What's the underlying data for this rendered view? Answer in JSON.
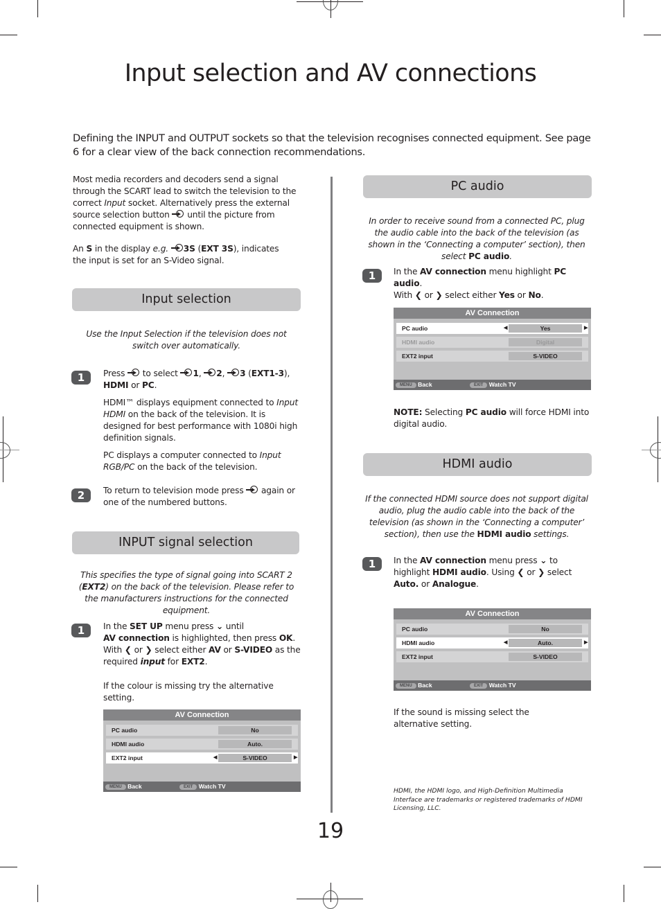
{
  "page": {
    "title": "Input selection and AV connections",
    "intro": "Defining the INPUT and OUTPUT sockets so that the television recognises connected equipment. See page 6 for a clear view of the back connection recommendations.",
    "page_number": "19"
  },
  "left": {
    "para1_a": "Most media recorders and decoders send a signal through the SCART lead to switch the television to the correct ",
    "para1_input": "Input",
    "para1_b": " socket. Alternatively press the external source selection button ",
    "para1_c": " until the picture from connected equipment is shown.",
    "para2_a": "An ",
    "para2_s": "S",
    "para2_b": " in the display ",
    "para2_eg": "e.g.",
    "para2_code": "3S",
    "para2_ext": "EXT 3S",
    "para2_c": "), indicates the input is set for an S-Video signal.",
    "input_selection": {
      "heading": "Input selection",
      "intro": "Use the Input Selection if the television does not switch over automatically.",
      "step1_num": "1",
      "step1_press": "Press ",
      "step1_toselect": " to select ",
      "step1_n1": "1",
      "step1_n2": "2",
      "step1_n3": "3",
      "step1_ext": "EXT1-3",
      "step1_hdmi": "HDMI",
      "step1_or": " or ",
      "step1_pc": "PC",
      "hdmi_a": "HDMI™ displays equipment connected to ",
      "hdmi_input": "Input HDMI",
      "hdmi_b": " on the back of the television. It is designed for best performance with 1080i high definition signals.",
      "pc_a": "PC displays a computer connected to ",
      "pc_input": "Input RGB/PC",
      "pc_b": " on the back of the television.",
      "step2_num": "2",
      "step2_a": "To return to television mode press ",
      "step2_b": " again or one of the numbered buttons."
    },
    "input_signal": {
      "heading": "INPUT signal selection",
      "intro_a": "This specifies the type of signal going into SCART 2 (",
      "intro_ext": "EXT2",
      "intro_b": ") on the back of the television. Please refer to the manufacturers instructions for the connected equipment.",
      "step1_num": "1",
      "s_a": "In the ",
      "s_setup": "SET UP",
      "s_b": " menu press ",
      "s_c": " until",
      "s_av": "AV connection",
      "s_d": " is highlighted, then press ",
      "s_ok": "OK",
      "s_with": "With ",
      "s_or": " or ",
      "s_e": " select either ",
      "s_avopt": "AV",
      "s_or2": " or ",
      "s_svideo": "S-VIDEO",
      "s_f": " as the required ",
      "s_input": "input",
      "s_for": " for ",
      "s_ext2": "EXT2",
      "note": "If the colour is missing try the alternative setting."
    }
  },
  "right": {
    "pc_audio": {
      "heading": "PC audio",
      "intro_a": "In order to receive sound from a connected PC, plug the audio cable into the back of the television (as shown in the ‘Connecting a computer’ section), then select ",
      "intro_b": "PC audio",
      "step1_num": "1",
      "s_a": "In the ",
      "s_av": "AV connection",
      "s_b": " menu highlight ",
      "s_pc": "PC audio",
      "s_with": "With ",
      "s_or": " or ",
      "s_c": " select either ",
      "s_yes": "Yes",
      "s_or2": " or ",
      "s_no": "No",
      "note_label": "NOTE:",
      "note_a": " Selecting ",
      "note_pc": "PC audio",
      "note_b": " will force HDMI into digital audio."
    },
    "hdmi_audio": {
      "heading": "HDMI audio",
      "intro_a": "If the connected HDMI source does not support digital audio, plug the audio cable into the back of the television (as shown in the ‘Connecting a computer’ section), then use the ",
      "intro_b": "HDMI audio",
      "intro_c": " settings.",
      "step1_num": "1",
      "s_a": "In the ",
      "s_av": "AV connection",
      "s_b": " menu press ",
      "s_c": " to highlight ",
      "s_hdmi": "HDMI audio",
      "s_d": ". Using ",
      "s_or": " or ",
      "s_e": " select ",
      "s_auto": "Auto.",
      "s_or2": " or ",
      "s_analogue": "Analogue",
      "note": "If the sound is missing select the alternative setting.",
      "trademark": "HDMI, the HDMI logo, and High-Definition Multimedia Interface are trademarks or registered trademarks of HDMI Licensing, LLC."
    }
  },
  "menus": {
    "title": "AV Connection",
    "labels": [
      "PC audio",
      "HDMI audio",
      "EXT2 input"
    ],
    "footer_menu_key": "MENU",
    "footer_back": "Back",
    "footer_exit_key": "EXIT",
    "footer_watch": "Watch TV",
    "ext2_menu": {
      "values": [
        "No",
        "Auto.",
        "S-VIDEO"
      ],
      "highlighted_row": "EXT2 input"
    },
    "pc_audio_menu": {
      "values": [
        "Yes",
        "Digital",
        "S-VIDEO"
      ],
      "highlighted_row": "PC audio",
      "disabled_row": "HDMI audio"
    },
    "hdmi_audio_menu": {
      "values": [
        "No",
        "Auto.",
        "S-VIDEO"
      ],
      "highlighted_row": "HDMI audio"
    }
  },
  "icons": {
    "source": "external-source-icon",
    "down": "⌄",
    "left": "❮",
    "right": "❯",
    "arrow_left": "◀",
    "arrow_right": "▶"
  }
}
